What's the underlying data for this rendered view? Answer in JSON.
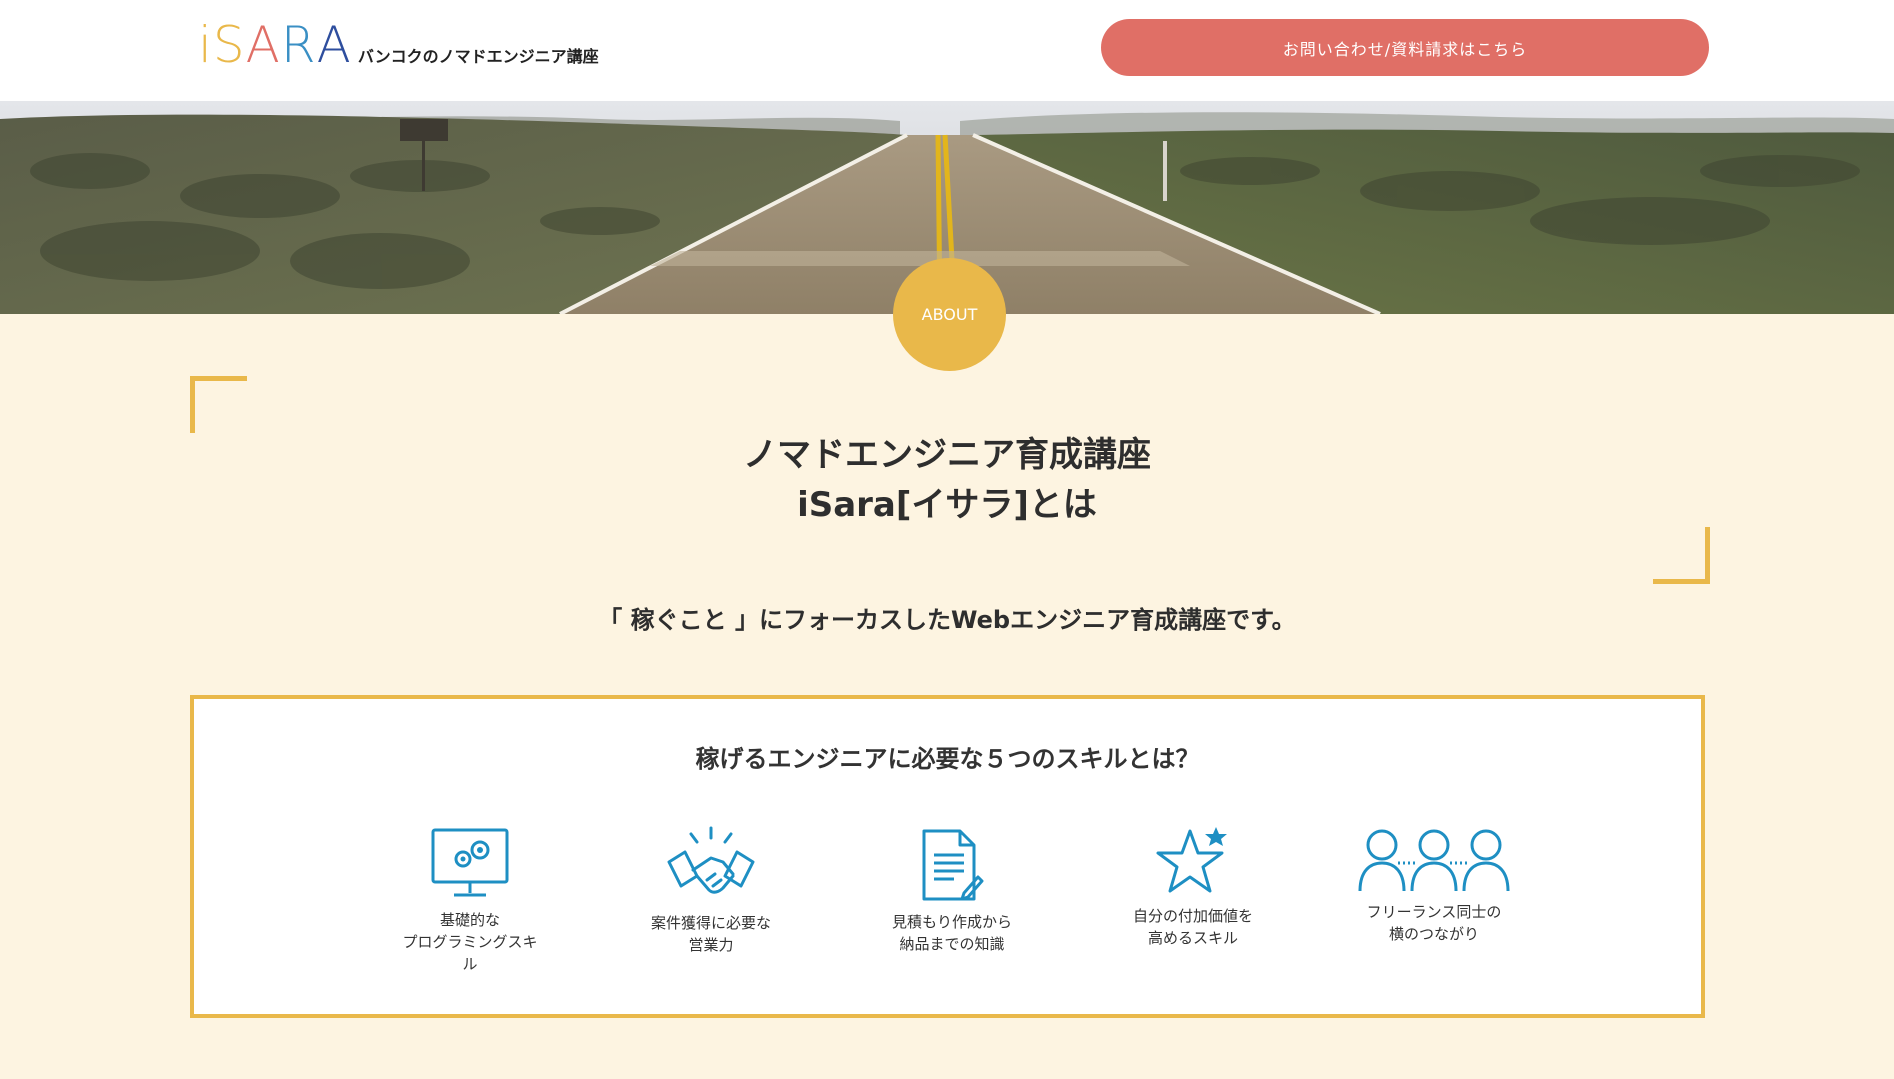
{
  "header": {
    "logo_letters": [
      "i",
      "S",
      "A",
      "R",
      "A"
    ],
    "logo_colors": [
      "#e9b84a",
      "#e9b84a",
      "#e06f66",
      "#3a8fc4",
      "#2e4e9e"
    ],
    "logo_tagline": "バンコクのノマドエンジニア講座",
    "cta_label": "お問い合わせ/資料請求はこちら",
    "cta_color": "#e06f66"
  },
  "about": {
    "badge": "ABOUT",
    "accent_color": "#e9b84a",
    "title_line1": "ノマドエンジニア育成講座",
    "title_line2": "iSara[イサラ]とは",
    "lead": "「 稼ぐこと 」にフォーカスしたWebエンジニア育成講座です。"
  },
  "skills": {
    "title": "稼げるエンジニアに必要な５つのスキルとは？",
    "icon_color": "#1e8fc3",
    "items": [
      {
        "icon": "monitor-gears-icon",
        "lines": [
          "基礎的な",
          "プログラミングスキ",
          "ル"
        ]
      },
      {
        "icon": "handshake-icon",
        "lines": [
          "案件獲得に必要な",
          "営業力"
        ]
      },
      {
        "icon": "document-pen-icon",
        "lines": [
          "見積もり作成から",
          "納品までの知識"
        ]
      },
      {
        "icon": "star-plus-one-icon",
        "lines": [
          "自分の付加価値を",
          "高めるスキル"
        ]
      },
      {
        "icon": "people-network-icon",
        "lines": [
          "フリーランス同士の",
          "横のつながり"
        ]
      }
    ]
  }
}
